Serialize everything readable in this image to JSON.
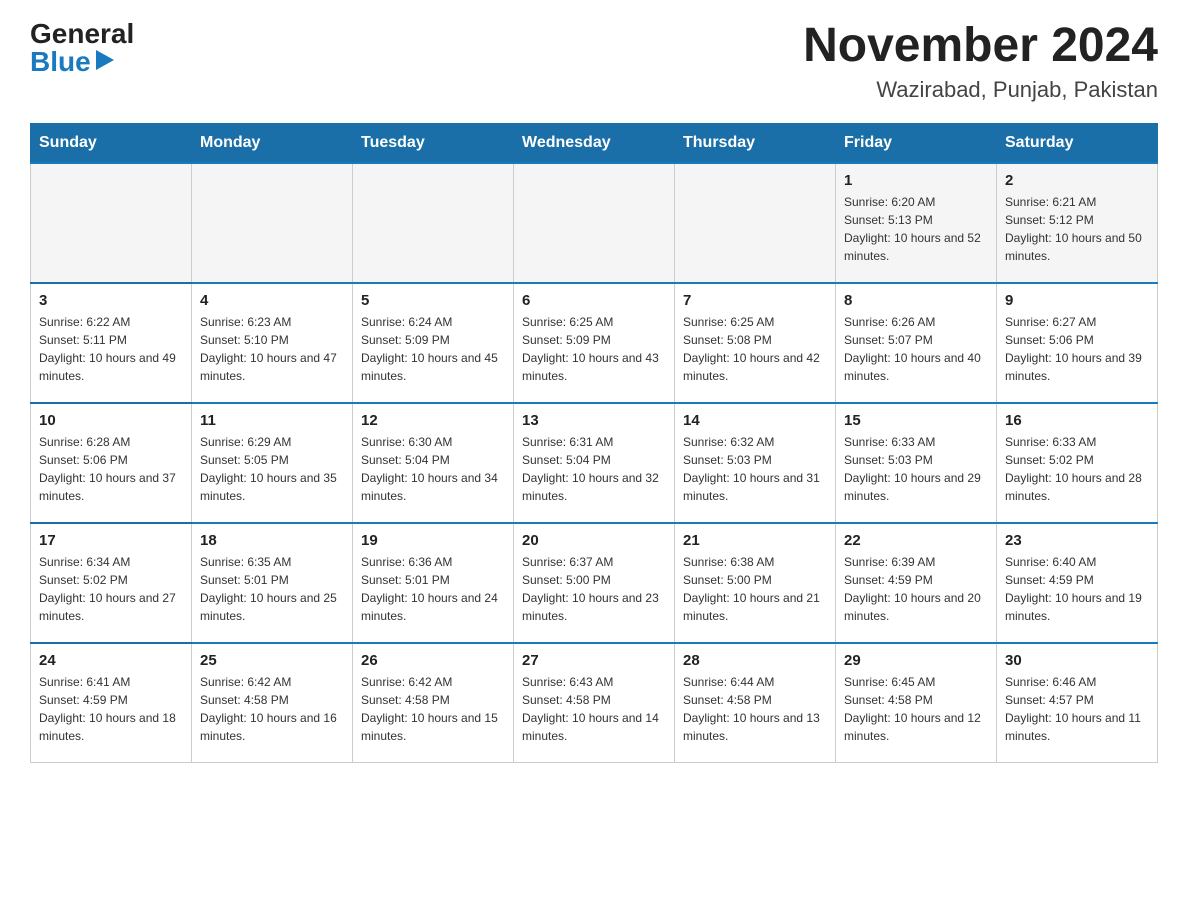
{
  "header": {
    "logo_general": "General",
    "logo_blue": "Blue",
    "month_year": "November 2024",
    "location": "Wazirabad, Punjab, Pakistan"
  },
  "weekdays": [
    "Sunday",
    "Monday",
    "Tuesday",
    "Wednesday",
    "Thursday",
    "Friday",
    "Saturday"
  ],
  "weeks": [
    {
      "days": [
        {
          "number": "",
          "info": ""
        },
        {
          "number": "",
          "info": ""
        },
        {
          "number": "",
          "info": ""
        },
        {
          "number": "",
          "info": ""
        },
        {
          "number": "",
          "info": ""
        },
        {
          "number": "1",
          "info": "Sunrise: 6:20 AM\nSunset: 5:13 PM\nDaylight: 10 hours and 52 minutes."
        },
        {
          "number": "2",
          "info": "Sunrise: 6:21 AM\nSunset: 5:12 PM\nDaylight: 10 hours and 50 minutes."
        }
      ]
    },
    {
      "days": [
        {
          "number": "3",
          "info": "Sunrise: 6:22 AM\nSunset: 5:11 PM\nDaylight: 10 hours and 49 minutes."
        },
        {
          "number": "4",
          "info": "Sunrise: 6:23 AM\nSunset: 5:10 PM\nDaylight: 10 hours and 47 minutes."
        },
        {
          "number": "5",
          "info": "Sunrise: 6:24 AM\nSunset: 5:09 PM\nDaylight: 10 hours and 45 minutes."
        },
        {
          "number": "6",
          "info": "Sunrise: 6:25 AM\nSunset: 5:09 PM\nDaylight: 10 hours and 43 minutes."
        },
        {
          "number": "7",
          "info": "Sunrise: 6:25 AM\nSunset: 5:08 PM\nDaylight: 10 hours and 42 minutes."
        },
        {
          "number": "8",
          "info": "Sunrise: 6:26 AM\nSunset: 5:07 PM\nDaylight: 10 hours and 40 minutes."
        },
        {
          "number": "9",
          "info": "Sunrise: 6:27 AM\nSunset: 5:06 PM\nDaylight: 10 hours and 39 minutes."
        }
      ]
    },
    {
      "days": [
        {
          "number": "10",
          "info": "Sunrise: 6:28 AM\nSunset: 5:06 PM\nDaylight: 10 hours and 37 minutes."
        },
        {
          "number": "11",
          "info": "Sunrise: 6:29 AM\nSunset: 5:05 PM\nDaylight: 10 hours and 35 minutes."
        },
        {
          "number": "12",
          "info": "Sunrise: 6:30 AM\nSunset: 5:04 PM\nDaylight: 10 hours and 34 minutes."
        },
        {
          "number": "13",
          "info": "Sunrise: 6:31 AM\nSunset: 5:04 PM\nDaylight: 10 hours and 32 minutes."
        },
        {
          "number": "14",
          "info": "Sunrise: 6:32 AM\nSunset: 5:03 PM\nDaylight: 10 hours and 31 minutes."
        },
        {
          "number": "15",
          "info": "Sunrise: 6:33 AM\nSunset: 5:03 PM\nDaylight: 10 hours and 29 minutes."
        },
        {
          "number": "16",
          "info": "Sunrise: 6:33 AM\nSunset: 5:02 PM\nDaylight: 10 hours and 28 minutes."
        }
      ]
    },
    {
      "days": [
        {
          "number": "17",
          "info": "Sunrise: 6:34 AM\nSunset: 5:02 PM\nDaylight: 10 hours and 27 minutes."
        },
        {
          "number": "18",
          "info": "Sunrise: 6:35 AM\nSunset: 5:01 PM\nDaylight: 10 hours and 25 minutes."
        },
        {
          "number": "19",
          "info": "Sunrise: 6:36 AM\nSunset: 5:01 PM\nDaylight: 10 hours and 24 minutes."
        },
        {
          "number": "20",
          "info": "Sunrise: 6:37 AM\nSunset: 5:00 PM\nDaylight: 10 hours and 23 minutes."
        },
        {
          "number": "21",
          "info": "Sunrise: 6:38 AM\nSunset: 5:00 PM\nDaylight: 10 hours and 21 minutes."
        },
        {
          "number": "22",
          "info": "Sunrise: 6:39 AM\nSunset: 4:59 PM\nDaylight: 10 hours and 20 minutes."
        },
        {
          "number": "23",
          "info": "Sunrise: 6:40 AM\nSunset: 4:59 PM\nDaylight: 10 hours and 19 minutes."
        }
      ]
    },
    {
      "days": [
        {
          "number": "24",
          "info": "Sunrise: 6:41 AM\nSunset: 4:59 PM\nDaylight: 10 hours and 18 minutes."
        },
        {
          "number": "25",
          "info": "Sunrise: 6:42 AM\nSunset: 4:58 PM\nDaylight: 10 hours and 16 minutes."
        },
        {
          "number": "26",
          "info": "Sunrise: 6:42 AM\nSunset: 4:58 PM\nDaylight: 10 hours and 15 minutes."
        },
        {
          "number": "27",
          "info": "Sunrise: 6:43 AM\nSunset: 4:58 PM\nDaylight: 10 hours and 14 minutes."
        },
        {
          "number": "28",
          "info": "Sunrise: 6:44 AM\nSunset: 4:58 PM\nDaylight: 10 hours and 13 minutes."
        },
        {
          "number": "29",
          "info": "Sunrise: 6:45 AM\nSunset: 4:58 PM\nDaylight: 10 hours and 12 minutes."
        },
        {
          "number": "30",
          "info": "Sunrise: 6:46 AM\nSunset: 4:57 PM\nDaylight: 10 hours and 11 minutes."
        }
      ]
    }
  ]
}
